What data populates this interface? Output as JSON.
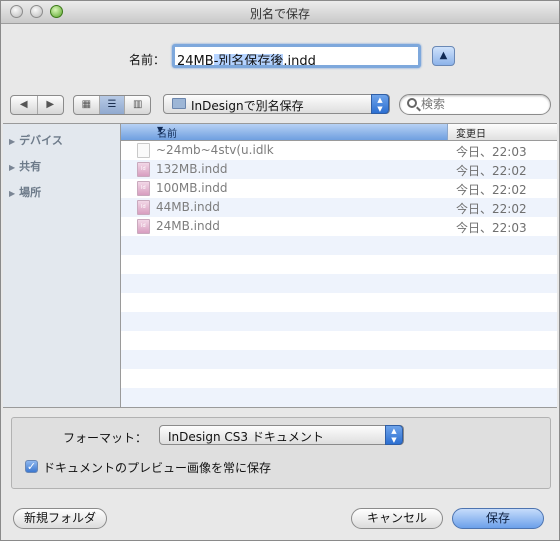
{
  "window": {
    "title": "別名で保存"
  },
  "save_name": {
    "label": "名前：",
    "value_prefix": "24MB",
    "value_selected": "-別名保存後",
    "value_suffix": ".indd"
  },
  "toolbar": {
    "back_icon": "triangle-left-icon",
    "forward_icon": "triangle-right-icon",
    "location": "InDesignで別名保存",
    "search_placeholder": "検索"
  },
  "sidebar": {
    "sections": [
      {
        "label": "デバイス"
      },
      {
        "label": "共有"
      },
      {
        "label": "場所"
      }
    ]
  },
  "file_list": {
    "columns": {
      "name": "名前",
      "date": "変更日"
    },
    "rows": [
      {
        "name": "~24mb~4stv(u.idlk",
        "date": "今日、22:03",
        "icon": "lock-file-icon"
      },
      {
        "name": "132MB.indd",
        "date": "今日、22:02",
        "icon": "indesign-file-icon"
      },
      {
        "name": "100MB.indd",
        "date": "今日、22:02",
        "icon": "indesign-file-icon"
      },
      {
        "name": "44MB.indd",
        "date": "今日、22:02",
        "icon": "indesign-file-icon"
      },
      {
        "name": "24MB.indd",
        "date": "今日、22:03",
        "icon": "indesign-file-icon"
      }
    ]
  },
  "options": {
    "format_label": "フォーマット：",
    "format_value": "InDesign CS3 ドキュメント",
    "preview_checkbox_label": "ドキュメントのプレビュー画像を常に保存",
    "preview_checked": true
  },
  "buttons": {
    "new_folder": "新規フォルダ",
    "cancel": "キャンセル",
    "save": "保存"
  },
  "colors": {
    "accent": "#3c78d0",
    "selection": "#b5d3ff"
  }
}
